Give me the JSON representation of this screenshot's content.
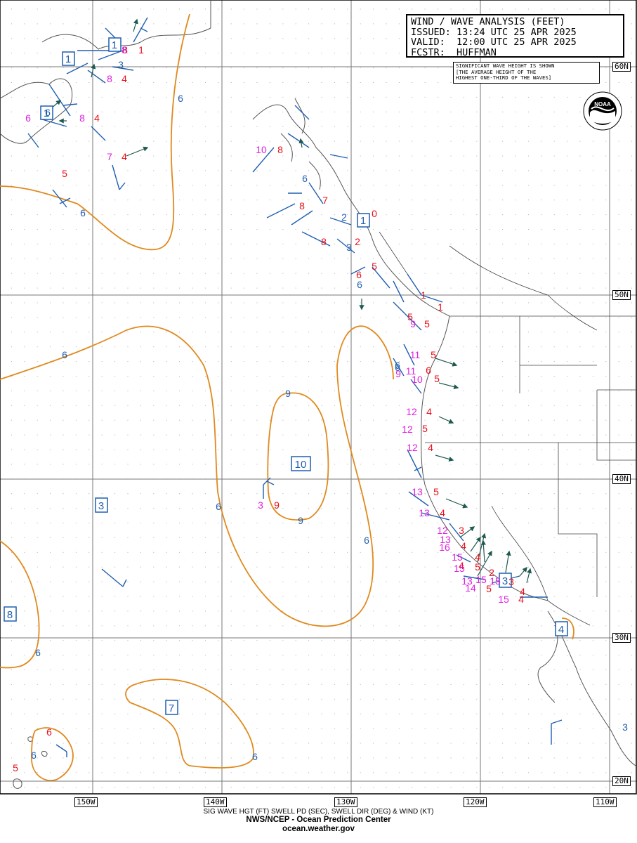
{
  "header": {
    "title": "WIND / WAVE ANALYSIS (FEET)",
    "issued": "ISSUED: 13:24 UTC 25 APR 2025",
    "valid": "VALID:  12:00 UTC 25 APR 2025",
    "forecaster": "FCSTR:  HUFFMAN"
  },
  "note": {
    "line1": "SIGNIFICANT WAVE HEIGHT IS SHOWN",
    "line2": "[THE AVERAGE HEIGHT OF THE",
    "line3": "HIGHEST ONE-THIRD OF THE WAVES]"
  },
  "logo": {
    "text": "NOAA",
    "icon": "noaa-logo-icon"
  },
  "latitude_labels": [
    "60N",
    "50N",
    "40N",
    "30N",
    "20N"
  ],
  "longitude_labels": [
    "150W",
    "140W",
    "130W",
    "120W",
    "110W"
  ],
  "footer": {
    "legend": "SIG WAVE HGT (FT) SWELL PD (SEC), SWELL DIR (DEG) & WIND (KT)",
    "agency": "NWS/NCEP - Ocean Prediction Center",
    "website": "ocean.weather.gov"
  },
  "colors": {
    "contour": "#e08a1e",
    "wave_height": "#e8101a",
    "swell_period": "#e020e0",
    "wind_barb": "#1f5fb0",
    "swell_arrow": "#1f5a50",
    "coastline": "#555555",
    "grid": "#888888"
  },
  "contour_labels": [
    "6",
    "6",
    "6",
    "6",
    "6",
    "6",
    "6",
    "6",
    "6",
    "9",
    "9",
    "6",
    "6"
  ],
  "box_labels": [
    "1",
    "1",
    "1",
    "1",
    "10",
    "3",
    "8",
    "7",
    "3",
    "4"
  ],
  "wave_heights": [
    "1",
    "8",
    "4",
    "4",
    "5",
    "4",
    "8",
    "8",
    "7",
    "0",
    "2",
    "5",
    "8",
    "6",
    "1",
    "1",
    "5",
    "5",
    "5",
    "6",
    "5",
    "4",
    "5",
    "4",
    "5",
    "4",
    "3",
    "4",
    "4",
    "4",
    "5",
    "2",
    "5",
    "4",
    "4",
    "9",
    "5",
    "6",
    "3"
  ],
  "swell_periods": [
    "8",
    "8",
    "6",
    "8",
    "7",
    "10",
    "9",
    "11",
    "11",
    "9",
    "10",
    "12",
    "12",
    "12",
    "13",
    "13",
    "12",
    "13",
    "16",
    "15",
    "15",
    "14",
    "13",
    "15",
    "15",
    "15",
    "3"
  ],
  "other_labels": [
    "3",
    "3",
    "3",
    "6",
    "6",
    "2"
  ]
}
